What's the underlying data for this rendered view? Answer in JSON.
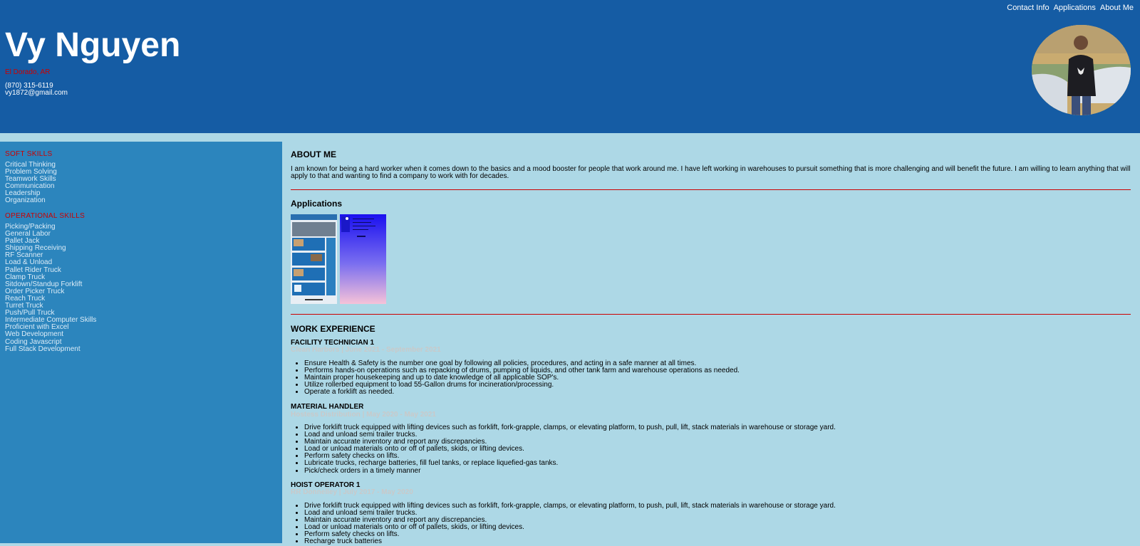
{
  "nav": [
    "Contact Info",
    "Applications",
    "About Me"
  ],
  "header": {
    "name": "Vy Nguyen",
    "location": "El Dorado, AR",
    "phone": "(870) 315-6119",
    "email": "vy1872@gmail.com"
  },
  "sidebar": {
    "soft_title": "SOFT SKILLS",
    "soft_skills": [
      "Critical Thinking",
      "Problem Solving",
      "Teamwork Skills",
      "Communication",
      "Leadership",
      "Organization"
    ],
    "op_title": "OPERATIONAL SKILLS",
    "op_skills": [
      "Picking/Packing",
      "General Labor",
      "Pallet Jack",
      "Shipping Receiving",
      "RF Scanner",
      "Load & Unload",
      "Pallet Rider Truck",
      "Clamp Truck",
      "Sitdown/Standup Forklift",
      "Order Picker Truck",
      "Reach Truck",
      "Turret Truck",
      "Push/Pull Truck",
      "Intermediate Computer Skills",
      "Proficient with Excel",
      "Web Development",
      "Coding Javascript",
      "Full Stack Development"
    ]
  },
  "about": {
    "title": "ABOUT ME",
    "text": "I am known for being a hard worker when it comes down to the basics and a mood booster for people that work around me. I have left working in warehouses to pursuit something that is more challenging and will benefit the future. I am willing to learn anything that will apply to that and wanting to find a company to work with for decades."
  },
  "applications": {
    "title": "Applications"
  },
  "work": {
    "title": "WORK EXPERIENCE",
    "jobs": [
      {
        "title": "FACILITY TECHNICIAN 1",
        "meta": "Clean Harbors | June 2021 - September 2021",
        "duties": [
          "Ensure Health & Safety is the number one goal by following all policies, procedures, and acting in a safe manner at all times.",
          "Performs hands-on operations such as repacking of drums, pumping of liquids, and other tank farm and warehouse operations as needed.",
          "Maintain proper housekeeping and up to date knowledge of all applicable SOP's.",
          "Utilize rollerbed equipment to load 55-Gallon drums for incineration/processing.",
          "Operate a forklift as needed."
        ]
      },
      {
        "title": "MATERIAL HANDLER",
        "meta": "Hostess Distribution | May 2020 - May 2021",
        "duties": [
          "Drive forklift truck equipped with lifting devices such as forklift, fork-grapple, clamps, or elevating platform, to push, pull, lift, stack materials in warehouse or storage yard.",
          "Load and unload semi trailer trucks.",
          "Maintain accurate inventory and report any discrepancies.",
          "Load or unload materials onto or off of pallets, skids, or lifting devices.",
          "Perform safety checks on lifts.",
          "Lubricate trucks, recharge batteries, fill fuel tanks, or replace liquefied-gas tanks.",
          "Pick/check orders in a timely manner"
        ]
      },
      {
        "title": "HOIST OPERATOR 1",
        "meta": "RR Donnelley | July 2017 - May 2020",
        "duties": [
          "Drive forklift truck equipped with lifting devices such as forklift, fork-grapple, clamps, or elevating platform, to push, pull, lift, stack materials in warehouse or storage yard.",
          "Load and unload semi trailer trucks.",
          "Maintain accurate inventory and report any discrepancies.",
          "Load or unload materials onto or off of pallets, skids, or lifting devices.",
          "Perform safety checks on lifts.",
          "Recharge truck batteries"
        ]
      }
    ]
  }
}
